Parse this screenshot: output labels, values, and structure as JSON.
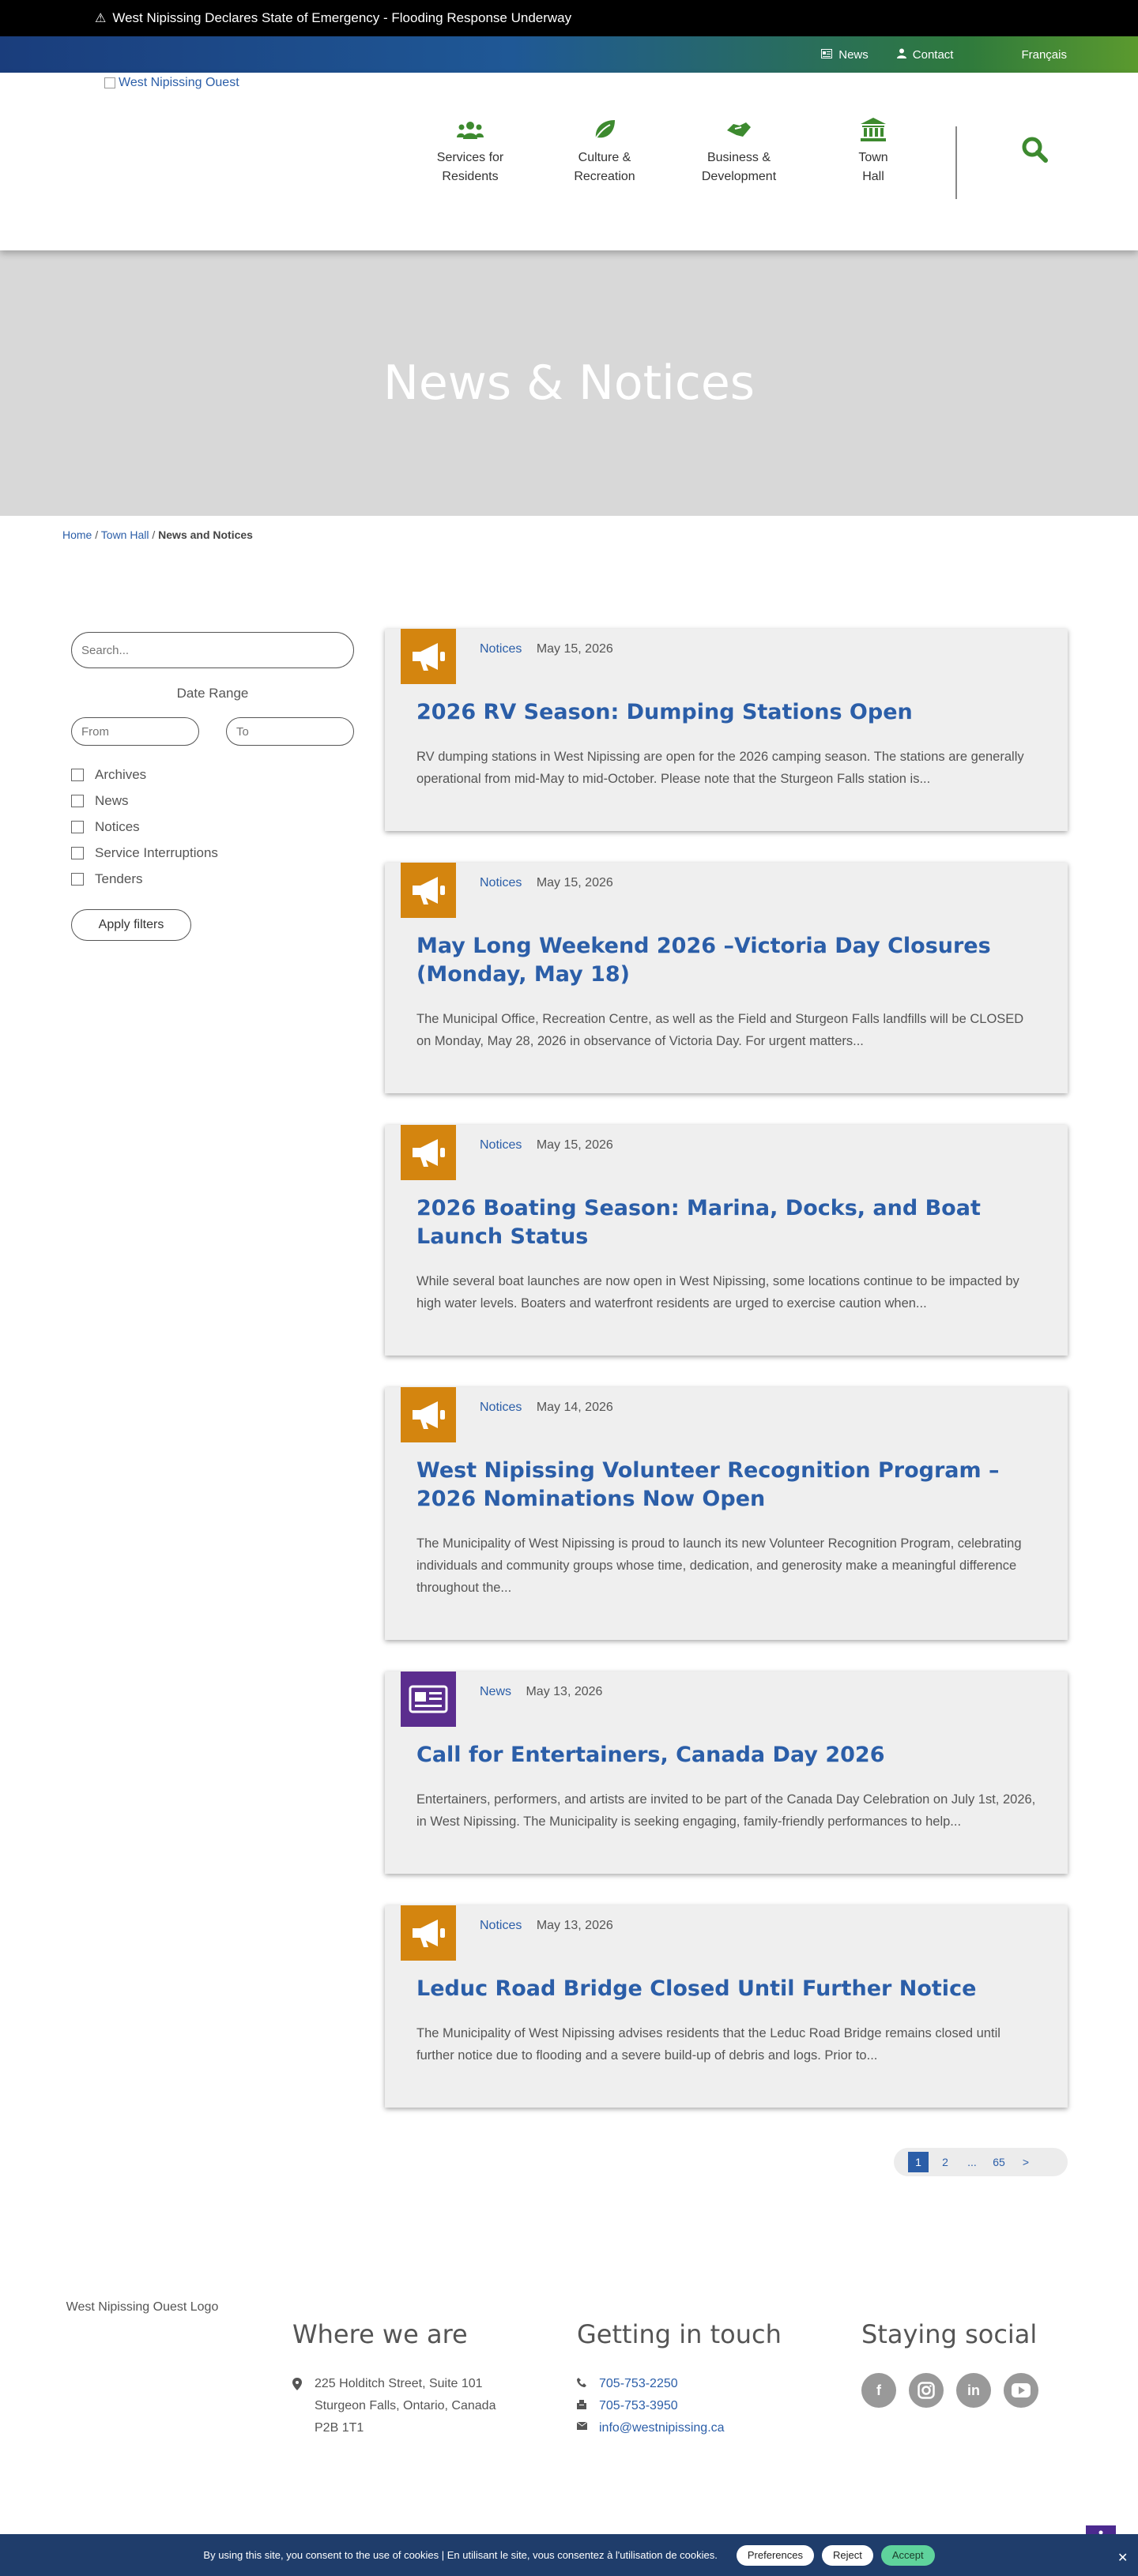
{
  "alert": {
    "text": "West Nipissing Declares State of Emergency - Flooding Response Underway"
  },
  "utility": {
    "news": "News",
    "contact": "Contact",
    "language": "Français"
  },
  "header": {
    "logo_alt": "West Nipissing Ouest",
    "nav": [
      {
        "line1": "Services for",
        "line2": "Residents",
        "icon": "people-icon"
      },
      {
        "line1": "Culture &",
        "line2": "Recreation",
        "icon": "leaf-icon"
      },
      {
        "line1": "Business &",
        "line2": "Development",
        "icon": "handshake-icon"
      },
      {
        "line1": "Town",
        "line2": "Hall",
        "icon": "town-hall-icon"
      }
    ]
  },
  "hero": {
    "title": "News & Notices"
  },
  "breadcrumb": {
    "home": "Home",
    "town_hall": "Town Hall",
    "current": "News and Notices"
  },
  "sidebar": {
    "search_placeholder": "Search...",
    "date_range": "Date Range",
    "from_placeholder": "From",
    "to_placeholder": "To",
    "filters": [
      "Archives",
      "News",
      "Notices",
      "Service Interruptions",
      "Tenders"
    ],
    "apply": "Apply filters"
  },
  "cards": [
    {
      "category": "Notices",
      "date": "May 15, 2026",
      "icon": "megaphone-icon",
      "badge_color": "#d4850f",
      "title": "2026 RV Season: Dumping Stations Open",
      "excerpt": "RV dumping stations in West Nipissing are open for the 2026 camping season. The stations are generally operational from mid-May to mid-October. Please note that the Sturgeon Falls station is..."
    },
    {
      "category": "Notices",
      "date": "May 15, 2026",
      "icon": "megaphone-icon",
      "badge_color": "#d4850f",
      "title": "May Long Weekend 2026 –Victoria Day Closures (Monday, May 18)",
      "excerpt": "The Municipal Office, Recreation Centre, as well as the Field and Sturgeon Falls landfills will be CLOSED on Monday, May 28, 2026 in observance of Victoria Day. For urgent matters..."
    },
    {
      "category": "Notices",
      "date": "May 15, 2026",
      "icon": "megaphone-icon",
      "badge_color": "#d4850f",
      "title": "2026 Boating Season: Marina, Docks, and Boat Launch Status",
      "excerpt": "While several boat launches are now open in West Nipissing, some locations continue to be impacted by high water levels. Boaters and waterfront residents are urged to exercise caution when..."
    },
    {
      "category": "Notices",
      "date": "May 14, 2026",
      "icon": "megaphone-icon",
      "badge_color": "#d4850f",
      "title": "West Nipissing Volunteer Recognition Program – 2026 Nominations Now Open",
      "excerpt": "The Municipality of West Nipissing is proud to launch its new Volunteer Recognition Program, celebrating individuals and community groups whose time, dedication, and generosity make a meaningful difference throughout the..."
    },
    {
      "category": "News",
      "date": "May 13, 2026",
      "icon": "newspaper-icon",
      "badge_color": "#5b2d8e",
      "title": "Call for Entertainers, Canada Day 2026",
      "excerpt": "Entertainers, performers, and artists are invited to be part of the Canada Day Celebration on July 1st, 2026, in West Nipissing. The Municipality is seeking engaging, family-friendly performances to help..."
    },
    {
      "category": "Notices",
      "date": "May 13, 2026",
      "icon": "megaphone-icon",
      "badge_color": "#d4850f",
      "title": "Leduc Road Bridge Closed Until Further Notice",
      "excerpt": "The Municipality of West Nipissing advises residents that the Leduc Road Bridge remains closed until further notice due to flooding and a severe build-up of debris and logs. Prior to..."
    }
  ],
  "pagination": {
    "pages": [
      "1",
      "2",
      "...",
      "65",
      ">"
    ],
    "current": "1"
  },
  "footer": {
    "logo_alt": "West Nipissing Ouest Logo",
    "where": {
      "title": "Where we are",
      "line1": "225 Holditch Street, Suite 101",
      "line2": "Sturgeon Falls, Ontario, Canada",
      "line3": "P2B 1T1"
    },
    "contact": {
      "title": "Getting in touch",
      "phone": "705-753-2250",
      "fax": "705-753-3950",
      "email": "info@westnipissing.ca"
    },
    "social": {
      "title": "Staying social",
      "networks": [
        "facebook-icon",
        "instagram-icon",
        "linkedin-icon",
        "youtube-icon"
      ]
    }
  },
  "cookie": {
    "text": "By using this site, you consent to the use of cookies | En utilisant le site, vous consentez à l'utilisation de cookies.",
    "preferences": "Preferences",
    "reject": "Reject",
    "accept": "Accept"
  },
  "colors": {
    "link": "#2b5ea8",
    "notice_badge": "#d4850f",
    "news_badge": "#5b2d8e",
    "nav_green": "#3d8a2f"
  }
}
